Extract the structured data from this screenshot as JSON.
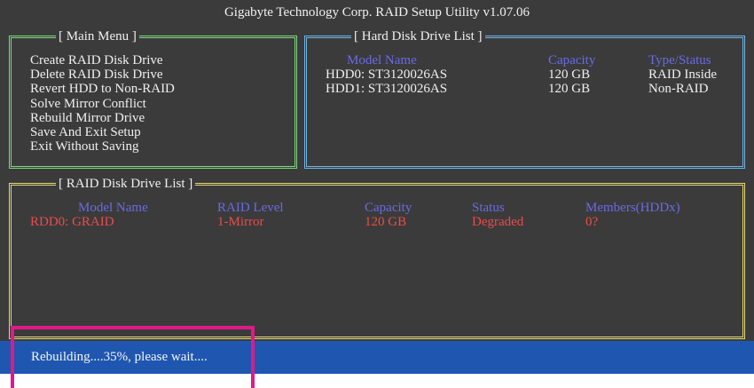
{
  "app": {
    "title": "Gigabyte Technology Corp.  RAID Setup Utility  v1.07.06"
  },
  "main_menu": {
    "title": "[ Main Menu ]",
    "items": [
      "Create RAID Disk Drive",
      "Delete RAID Disk Drive",
      "Revert HDD to Non-RAID",
      "Solve Mirror Conflict",
      "Rebuild Mirror Drive",
      "Save And Exit Setup",
      "Exit Without Saving"
    ]
  },
  "hdd_list": {
    "title": "[ Hard Disk Drive List ]",
    "headers": {
      "model": "Model Name",
      "capacity": "Capacity",
      "type": "Type/Status"
    },
    "rows": [
      {
        "model": "HDD0:  ST3120026AS",
        "capacity": "120 GB",
        "type": "RAID Inside"
      },
      {
        "model": "HDD1:  ST3120026AS",
        "capacity": "120 GB",
        "type": "Non-RAID"
      }
    ]
  },
  "raid_list": {
    "title": "[ RAID Disk Drive List ]",
    "headers": {
      "model": "Model Name",
      "level": "RAID Level",
      "capacity": "Capacity",
      "status": "Status",
      "members": "Members(HDDx)"
    },
    "rows": [
      {
        "model": "RDD0: GRAID",
        "level": "1-Mirror",
        "capacity": "120 GB",
        "status": "Degraded",
        "members": "0?"
      }
    ]
  },
  "status_bar": {
    "text": "Rebuilding....35%, please wait...."
  },
  "colors": {
    "background": "#3b3b3b",
    "main_menu_border": "#7fd97f",
    "hdd_border": "#6fb6e6",
    "raid_border": "#e6d96f",
    "header_text": "#6a6ae6",
    "raid_value_text": "#ee4a4a",
    "status_bar": "#1f57b0",
    "highlight": "#e0198a"
  }
}
